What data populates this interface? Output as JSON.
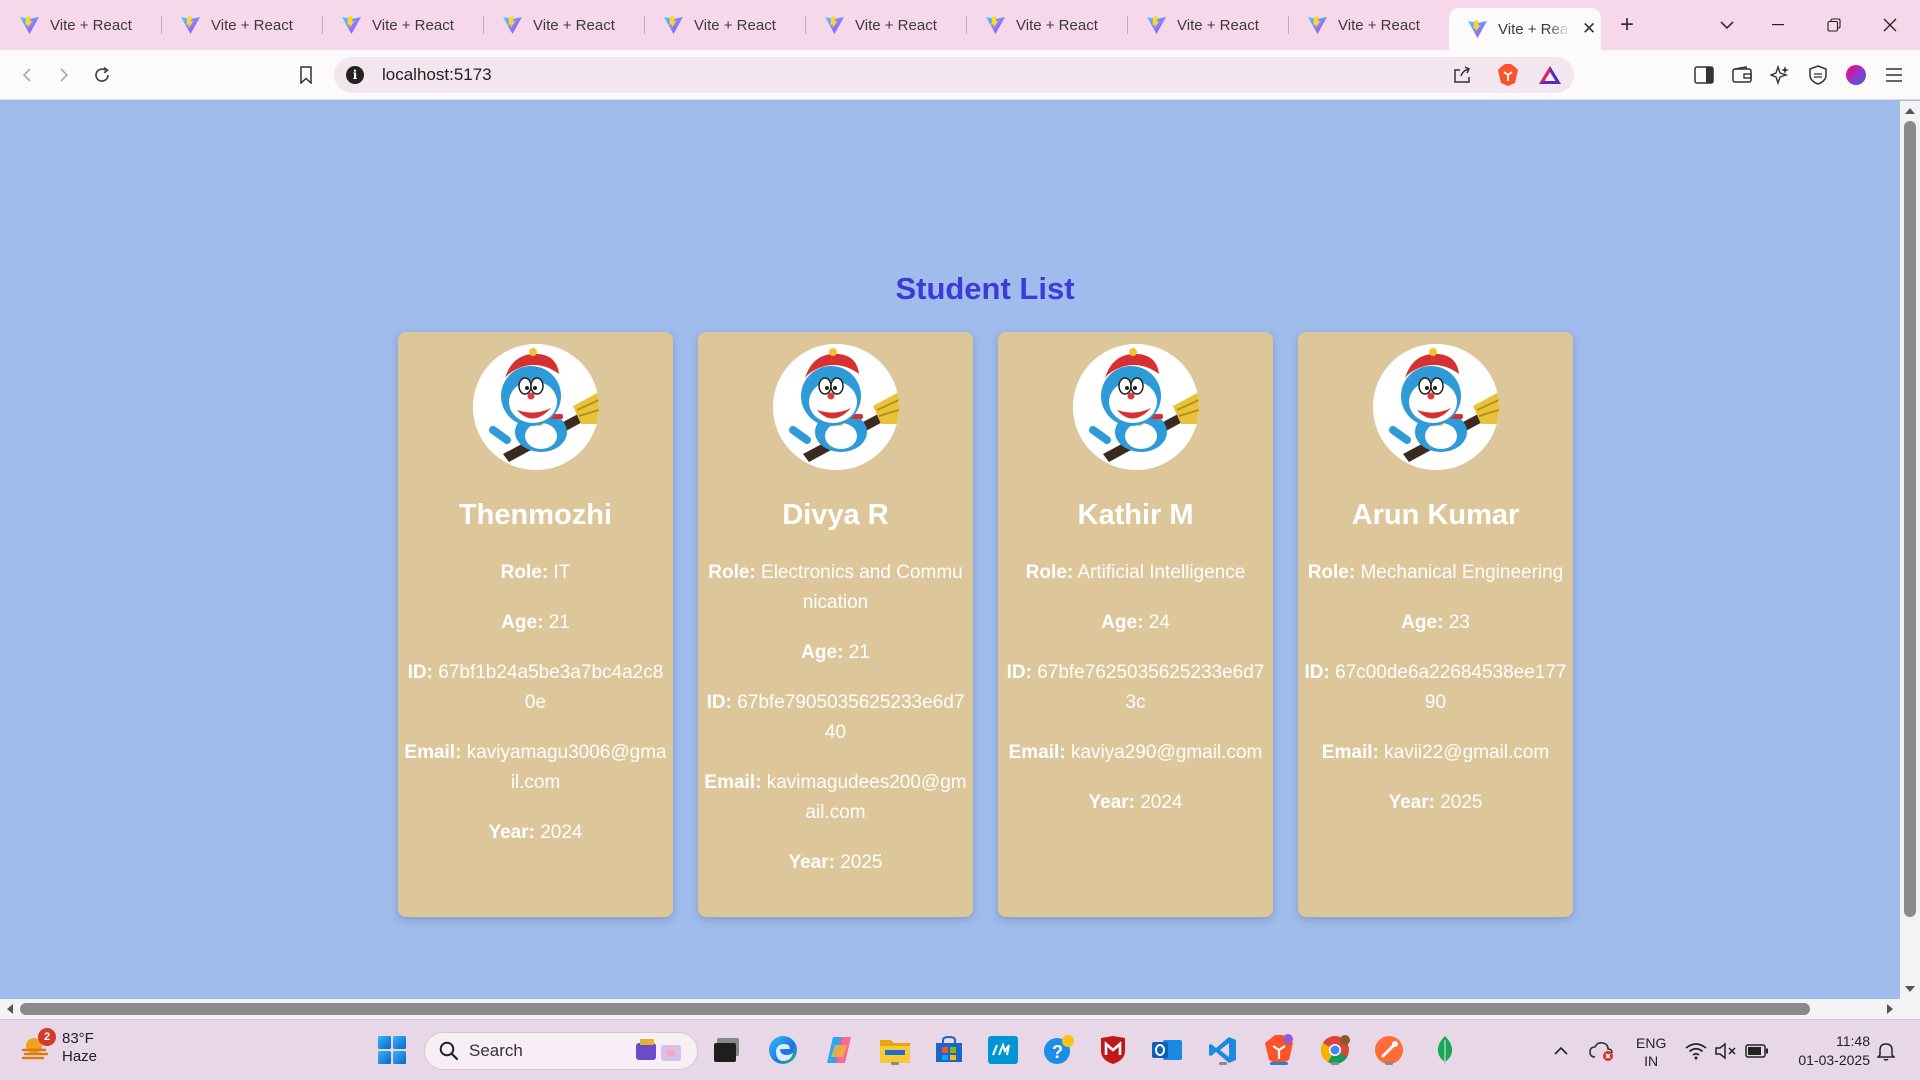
{
  "browser": {
    "tabs": [
      {
        "title": "Vite + React",
        "active": false
      },
      {
        "title": "Vite + React",
        "active": false
      },
      {
        "title": "Vite + React",
        "active": false
      },
      {
        "title": "Vite + React",
        "active": false
      },
      {
        "title": "Vite + React",
        "active": false
      },
      {
        "title": "Vite + React",
        "active": false
      },
      {
        "title": "Vite + React",
        "active": false
      },
      {
        "title": "Vite + React",
        "active": false
      },
      {
        "title": "Vite + React",
        "active": false
      },
      {
        "title": "Vite + React",
        "active": true
      }
    ],
    "new_tab_symbol": "+",
    "close_symbol": "✕",
    "url": "localhost:5173",
    "colors": {
      "tab_strip": "#f7d7ea",
      "toolbar": "#fdfafc",
      "brave": "#fb542b"
    }
  },
  "page": {
    "title": "Student List",
    "labels": {
      "role": "Role:",
      "age": "Age:",
      "id": "ID:",
      "email": "Email:",
      "year": "Year:"
    },
    "students": [
      {
        "name": "Thenmozhi",
        "role": "IT",
        "age": "21",
        "id": "67bf1b24a5be3a7bc4a2c80e",
        "email": "kaviyamagu3006@gmail.com",
        "year": "2024"
      },
      {
        "name": "Divya R",
        "role": "Electronics and Communication",
        "age": "21",
        "id": "67bfe7905035625233e6d740",
        "email": "kavimagudees200@gmail.com",
        "year": "2025"
      },
      {
        "name": "Kathir M",
        "role": "Artificial Intelligence",
        "age": "24",
        "id": "67bfe7625035625233e6d73c",
        "email": "kaviya290@gmail.com",
        "year": "2024"
      },
      {
        "name": "Arun Kumar",
        "role": "Mechanical Engineering",
        "age": "23",
        "id": "67c00de6a22684538ee17790",
        "email": "kavii22@gmail.com",
        "year": "2025"
      }
    ],
    "colors": {
      "background": "#9fbcec",
      "card": "#dcc69a",
      "title": "#3d3bd8",
      "card_text": "#ffffff"
    }
  },
  "taskbar": {
    "weather": {
      "temp": "83°F",
      "condition": "Haze",
      "badge": "2"
    },
    "search_label": "Search",
    "language": {
      "line1": "ENG",
      "line2": "IN"
    },
    "clock": {
      "time": "11:48",
      "date": "01-03-2025"
    }
  }
}
